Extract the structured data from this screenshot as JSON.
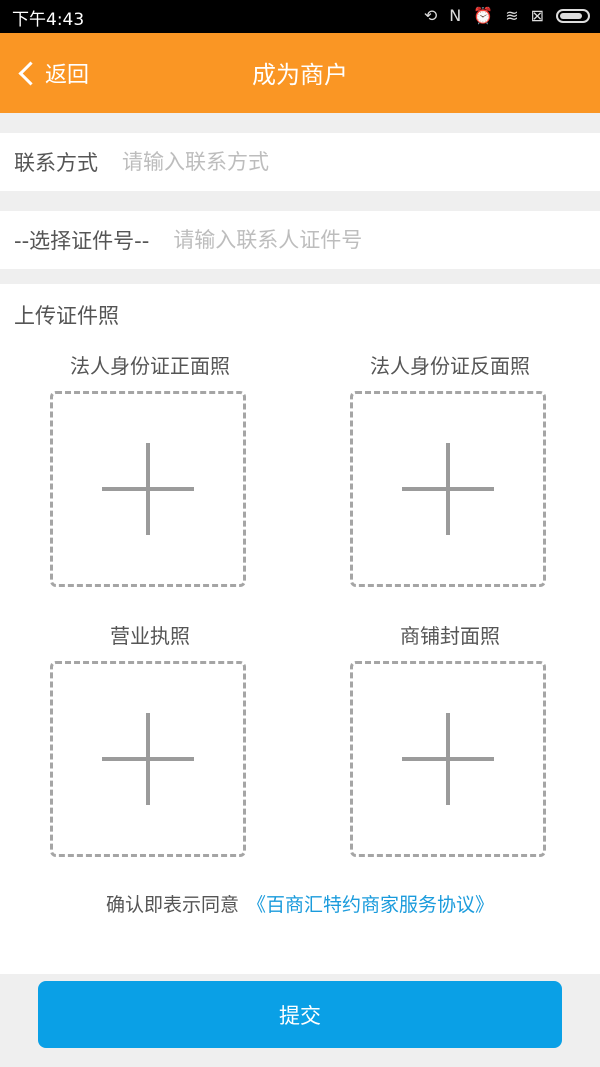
{
  "status_bar": {
    "time": "下午4:43",
    "icons": [
      "sync-icon",
      "nfc-icon",
      "alarm-icon",
      "wifi-icon",
      "sim-icon",
      "battery-icon"
    ]
  },
  "nav": {
    "back_label": "返回",
    "title": "成为商户"
  },
  "form": {
    "contact_label": "联系方式",
    "contact_placeholder": "请输入联系方式",
    "id_type_label": "--选择证件号--",
    "id_placeholder": "请输入联系人证件号"
  },
  "upload": {
    "title": "上传证件照",
    "items": [
      {
        "label": "法人身份证正面照"
      },
      {
        "label": "法人身份证反面照"
      },
      {
        "label": "营业执照"
      },
      {
        "label": "商铺封面照"
      }
    ]
  },
  "agreement": {
    "prefix": "确认即表示同意",
    "link": "《百商汇特约商家服务协议》"
  },
  "submit_label": "提交",
  "colors": {
    "nav_bg": "#fa9624",
    "submit_bg": "#0aa0e6",
    "link": "#1a9bdc"
  }
}
